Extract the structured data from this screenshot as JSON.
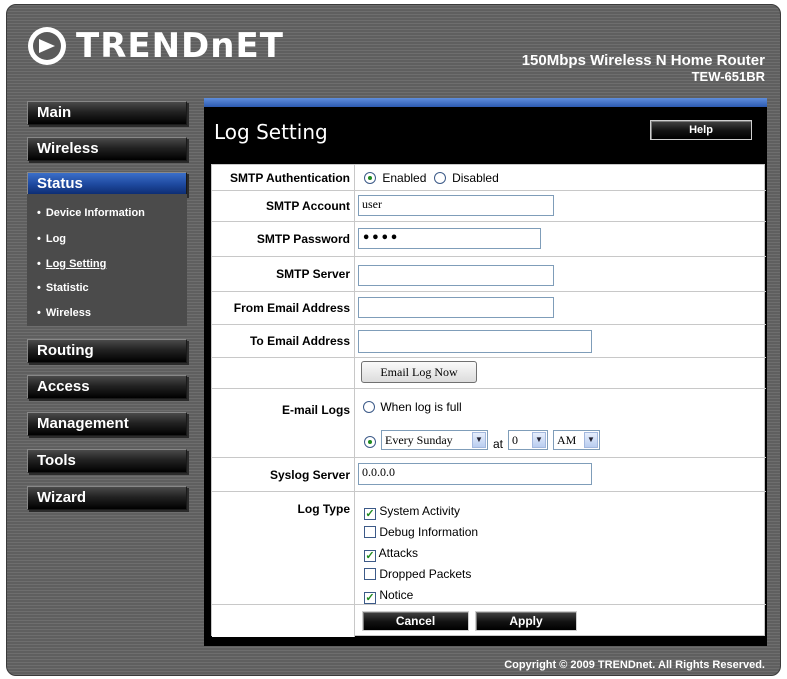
{
  "brand": {
    "logo_text": "TRENDnET",
    "product_name": "150Mbps Wireless N Home Router",
    "model": "TEW-651BR"
  },
  "sidebar": {
    "main": "Main",
    "wireless": "Wireless",
    "status": "Status",
    "status_items": [
      "Device Information",
      "Log",
      "Log Setting",
      "Statistic",
      "Wireless"
    ],
    "routing": "Routing",
    "access": "Access",
    "management": "Management",
    "tools": "Tools",
    "wizard": "Wizard"
  },
  "page": {
    "title": "Log Setting",
    "help": "Help"
  },
  "form": {
    "smtp_auth": {
      "label": "SMTP Authentication",
      "enabled": "Enabled",
      "disabled": "Disabled",
      "selected": "Enabled"
    },
    "smtp_account": {
      "label": "SMTP Account",
      "value": "user"
    },
    "smtp_password": {
      "label": "SMTP Password",
      "value": "••••"
    },
    "smtp_server": {
      "label": "SMTP Server",
      "value": ""
    },
    "from_email": {
      "label": "From Email Address",
      "value": ""
    },
    "to_email": {
      "label": "To Email Address",
      "value": ""
    },
    "email_log_now": "Email Log Now",
    "email_logs": {
      "label": "E-mail Logs",
      "option_full": "When log is full",
      "schedule_day": "Every Sunday",
      "at": "at",
      "hour": "0",
      "ampm": "AM"
    },
    "syslog_server": {
      "label": "Syslog Server",
      "value": "0.0.0.0"
    },
    "log_type": {
      "label": "Log Type",
      "items": [
        {
          "label": "System Activity",
          "checked": "true"
        },
        {
          "label": "Debug Information",
          "checked": "false"
        },
        {
          "label": "Attacks",
          "checked": "true"
        },
        {
          "label": "Dropped Packets",
          "checked": "false"
        },
        {
          "label": "Notice",
          "checked": "true"
        }
      ]
    },
    "cancel": "Cancel",
    "apply": "Apply"
  },
  "footer": {
    "copyright": "Copyright © 2009 TRENDnet. All Rights Reserved."
  }
}
